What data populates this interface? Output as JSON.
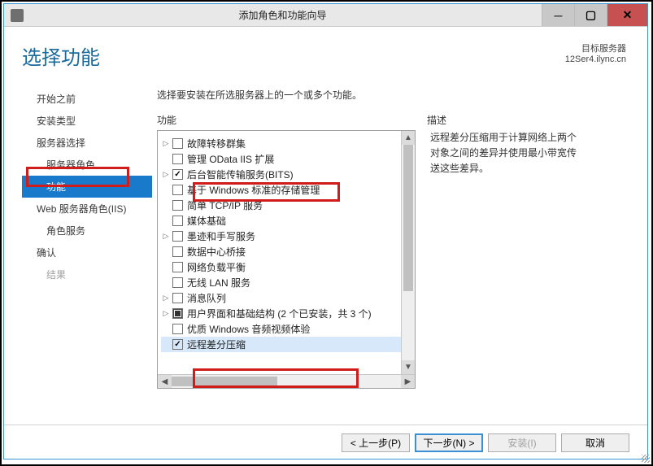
{
  "window": {
    "title": "添加角色和功能向导"
  },
  "header": {
    "page_title": "选择功能",
    "server_label": "目标服务器",
    "server_name": "12Ser4.ilync.cn"
  },
  "nav": {
    "items": [
      {
        "label": "开始之前",
        "selected": false,
        "disabled": false,
        "indent": false
      },
      {
        "label": "安装类型",
        "selected": false,
        "disabled": false,
        "indent": false
      },
      {
        "label": "服务器选择",
        "selected": false,
        "disabled": false,
        "indent": false
      },
      {
        "label": "服务器角色",
        "selected": false,
        "disabled": false,
        "indent": true
      },
      {
        "label": "功能",
        "selected": true,
        "disabled": false,
        "indent": true
      },
      {
        "label": "Web 服务器角色(IIS)",
        "selected": false,
        "disabled": false,
        "indent": false
      },
      {
        "label": "角色服务",
        "selected": false,
        "disabled": false,
        "indent": true
      },
      {
        "label": "确认",
        "selected": false,
        "disabled": false,
        "indent": false
      },
      {
        "label": "结果",
        "selected": false,
        "disabled": true,
        "indent": true
      }
    ]
  },
  "main": {
    "instruction": "选择要安装在所选服务器上的一个或多个功能。",
    "features_label": "功能",
    "description_label": "描述",
    "description_text": "远程差分压缩用于计算网络上两个对象之间的差异并使用最小带宽传送这些差异。",
    "tree": [
      {
        "label": "故障转移群集",
        "checked": false,
        "exp": "right"
      },
      {
        "label": "管理 OData IIS 扩展",
        "checked": false,
        "exp": ""
      },
      {
        "label": "后台智能传输服务(BITS)",
        "checked": true,
        "exp": "right"
      },
      {
        "label": "基于 Windows 标准的存储管理",
        "checked": false,
        "exp": ""
      },
      {
        "label": "简单 TCP/IP 服务",
        "checked": false,
        "exp": ""
      },
      {
        "label": "媒体基础",
        "checked": false,
        "exp": ""
      },
      {
        "label": "墨迹和手写服务",
        "checked": false,
        "exp": "right"
      },
      {
        "label": "数据中心桥接",
        "checked": false,
        "exp": ""
      },
      {
        "label": "网络负载平衡",
        "checked": false,
        "exp": ""
      },
      {
        "label": "无线 LAN 服务",
        "checked": false,
        "exp": ""
      },
      {
        "label": "消息队列",
        "checked": false,
        "exp": "right"
      },
      {
        "label": "用户界面和基础结构 (2 个已安装，共 3 个)",
        "checked": "partial",
        "exp": "right"
      },
      {
        "label": "优质 Windows 音频视频体验",
        "checked": false,
        "exp": ""
      },
      {
        "label": "远程差分压缩",
        "checked": true,
        "exp": "",
        "selected": true
      }
    ]
  },
  "footer": {
    "prev": "< 上一步(P)",
    "next": "下一步(N) >",
    "install": "安装(I)",
    "cancel": "取消"
  }
}
